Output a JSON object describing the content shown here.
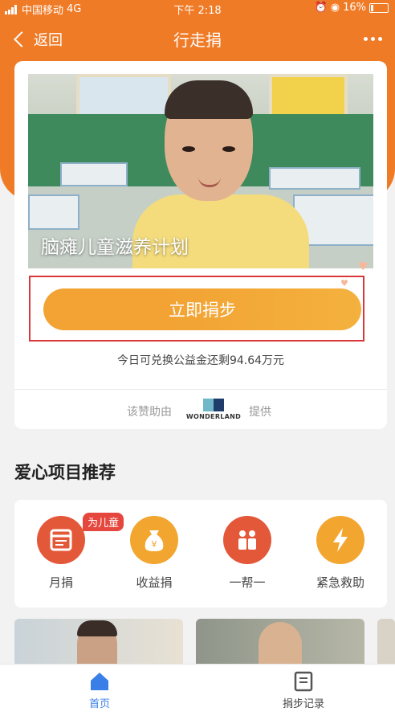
{
  "status_bar": {
    "carrier": "中国移动",
    "network": "4G",
    "time": "下午 2:18",
    "battery": "16%"
  },
  "nav": {
    "back_label": "返回",
    "title": "行走捐"
  },
  "hero": {
    "title": "脑瘫儿童滋养计划"
  },
  "donate_button": {
    "label": "立即捐步"
  },
  "remaining_text": "今日可兑换公益金还剩94.64万元",
  "sponsor": {
    "prefix": "该赞助由",
    "logo_text": "WONDERLAND",
    "suffix": "提供"
  },
  "section": {
    "title": "爱心项目推荐"
  },
  "projects": [
    {
      "label": "月捐",
      "icon": "calendar-icon",
      "badge": "为儿童",
      "color": "#e4583a"
    },
    {
      "label": "收益捐",
      "icon": "money-bag-icon",
      "color": "#f2a630"
    },
    {
      "label": "一帮一",
      "icon": "people-icon",
      "color": "#e4583a"
    },
    {
      "label": "紧急救助",
      "icon": "lightning-icon",
      "color": "#f2a630"
    }
  ],
  "tabbar": {
    "home_label": "首页",
    "records_label": "捐步记录"
  },
  "colors": {
    "primary": "#f07b26",
    "button": "#f2a334",
    "highlight": "#d9373b"
  }
}
